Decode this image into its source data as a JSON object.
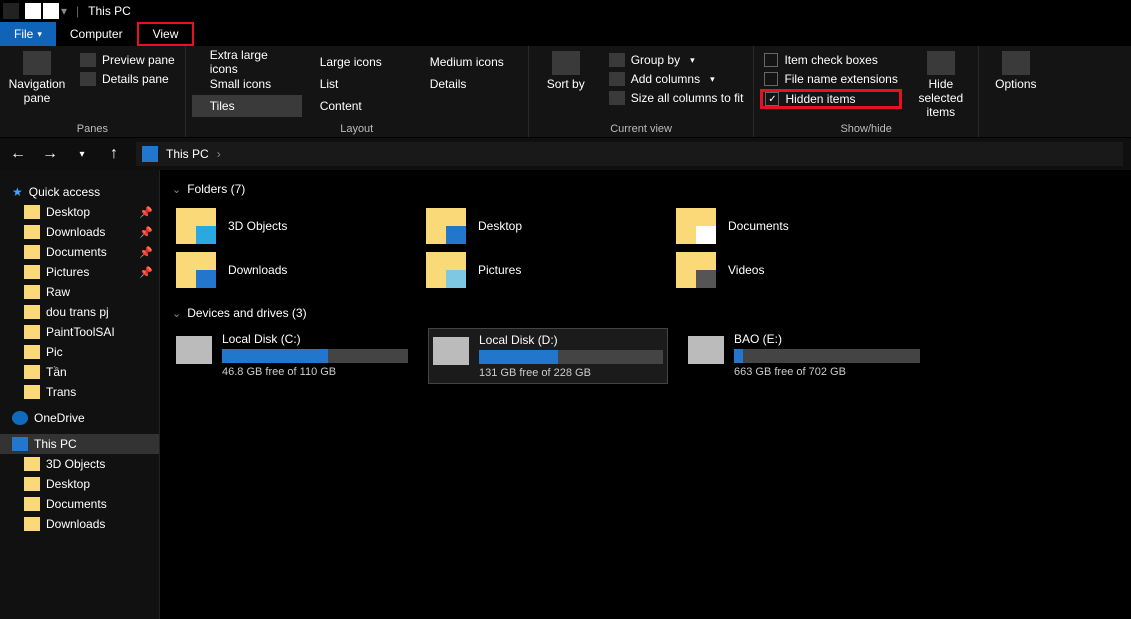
{
  "title": "This PC",
  "tabs": {
    "file": "File",
    "computer": "Computer",
    "view": "View"
  },
  "ribbon": {
    "panes": {
      "label": "Panes",
      "navigation": "Navigation pane",
      "preview": "Preview pane",
      "details": "Details pane"
    },
    "layout": {
      "label": "Layout",
      "xl": "Extra large icons",
      "lg": "Large icons",
      "md": "Medium icons",
      "sm": "Small icons",
      "list": "List",
      "details": "Details",
      "tiles": "Tiles",
      "content": "Content"
    },
    "current": {
      "label": "Current view",
      "sort": "Sort by",
      "group": "Group by",
      "addcols": "Add columns",
      "sizeall": "Size all columns to fit"
    },
    "show": {
      "label": "Show/hide",
      "checkboxes": "Item check boxes",
      "ext": "File name extensions",
      "hidden": "Hidden items",
      "hide": "Hide selected items"
    },
    "options": "Options"
  },
  "breadcrumb": {
    "root": "This PC",
    "chev": "›"
  },
  "sidebar": {
    "quick": "Quick access",
    "pinned": [
      "Desktop",
      "Downloads",
      "Documents",
      "Pictures",
      "Raw",
      "dou trans pj",
      "PaintToolSAI",
      "Pic",
      "Tần",
      "Trans"
    ],
    "onedrive": "OneDrive",
    "thispc": "This PC",
    "pcitems": [
      "3D Objects",
      "Desktop",
      "Documents",
      "Downloads"
    ]
  },
  "sections": {
    "folders": {
      "title": "Folders (7)",
      "items": [
        "3D Objects",
        "Desktop",
        "Documents",
        "Downloads",
        "Pictures",
        "Videos"
      ]
    },
    "drives": {
      "title": "Devices and drives (3)",
      "items": [
        {
          "name": "Local Disk (C:)",
          "free": "46.8 GB free of 110 GB",
          "pct": 57
        },
        {
          "name": "Local Disk (D:)",
          "free": "131 GB free of 228 GB",
          "pct": 43
        },
        {
          "name": "BAO (E:)",
          "free": "663 GB free of 702 GB",
          "pct": 5
        }
      ]
    }
  }
}
